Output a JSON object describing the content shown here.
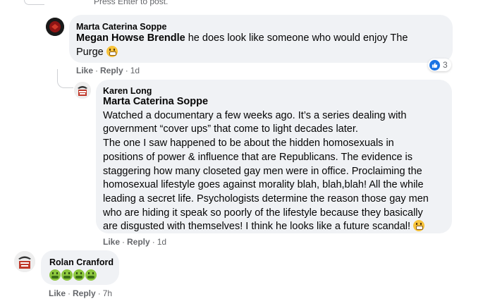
{
  "top": {
    "hint": "Press Enter to post."
  },
  "comments": [
    {
      "author": "Marta Caterina Soppe",
      "mention": "Megan Howse Brendle",
      "text_line1": " he does look like someone who would enjoy The",
      "text_line2": "Purge ",
      "emoji": "grimacing-face-icon",
      "reaction_count": "3",
      "reaction_icon": "like-icon",
      "actions": {
        "like": "Like",
        "reply": "Reply",
        "time": "1d"
      }
    },
    {
      "author": "Karen Long",
      "mention": "Marta Caterina Soppe",
      "lines": [
        "Watched a documentary a few weeks ago. It’s a series dealing with",
        "government “cover ups” that come to light decades later.",
        "The one I saw happened to be about the hidden homosexuals in",
        "positions of power & influence that are Republicans. The evidence is",
        "staggering how many closeted gay men were in office. Proclaiming the",
        "homosexual lifestyle goes against morality blah, blah,blah! All the while",
        "leading a secret life. Psychologists determine the reason those gay men",
        "who are hiding it speak so poorly of the lifestyle because they basically",
        "are disgusted with themselves! I think he looks like a future scandal! "
      ],
      "emoji": "grimacing-face-icon",
      "actions": {
        "like": "Like",
        "reply": "Reply",
        "time": "1d"
      }
    },
    {
      "author": "Rolan Cranford",
      "emojis": [
        "nauseated-face-icon",
        "nauseated-face-icon",
        "nauseated-face-icon",
        "nauseated-face-icon"
      ],
      "actions": {
        "like": "Like",
        "reply": "Reply",
        "time": "7h"
      }
    }
  ],
  "colors": {
    "bubble": "#f0f2f5",
    "thread_line": "#ced0d4",
    "meta_text": "#65676b",
    "like_blue": "#1b74e4"
  }
}
